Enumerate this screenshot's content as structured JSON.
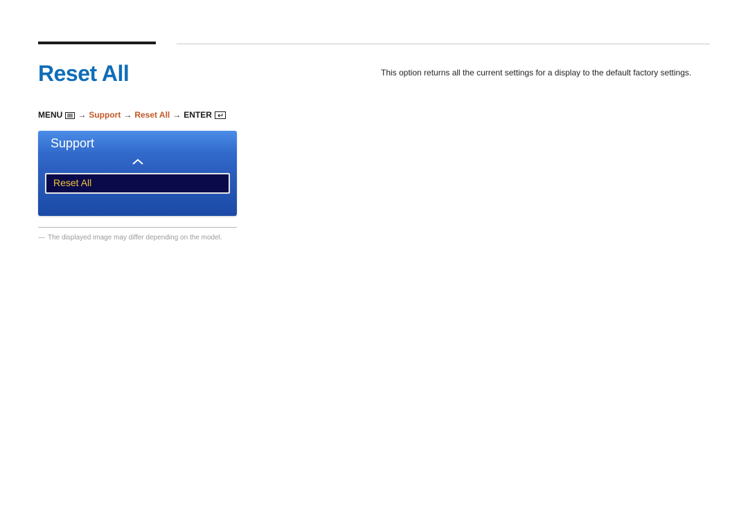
{
  "header": {
    "title": "Reset All"
  },
  "nav": {
    "menu_label": "MENU",
    "step1": "Support",
    "step2": "Reset All",
    "enter_label": "ENTER",
    "arrow": "→"
  },
  "panel": {
    "title": "Support",
    "selected_item": "Reset All"
  },
  "footnote": {
    "dash": "―",
    "text": "The displayed image may differ depending on the model."
  },
  "body": {
    "description": "This option returns all the current settings for a display to the default factory settings."
  }
}
